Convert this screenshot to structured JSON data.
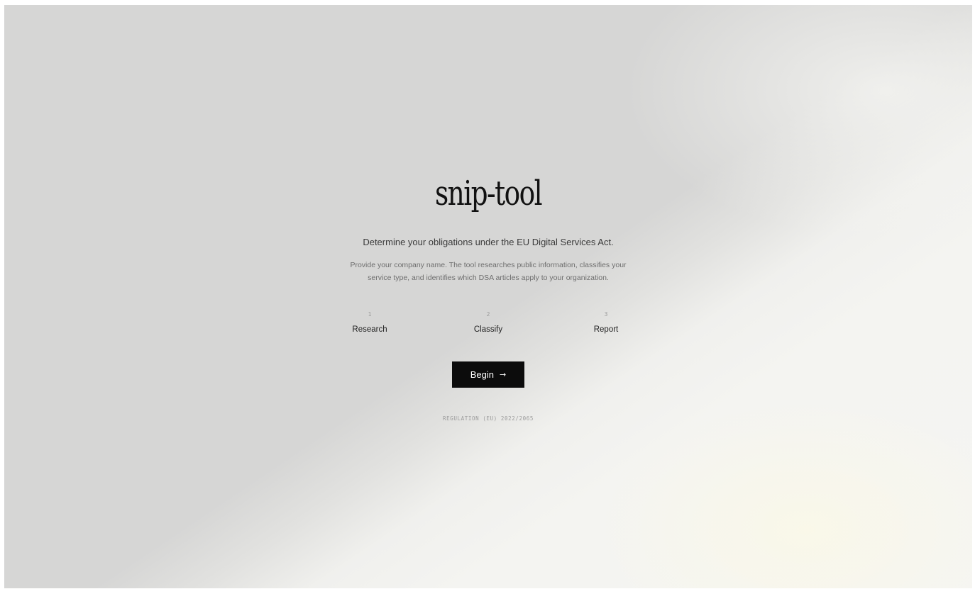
{
  "app": {
    "title": "snip-tool",
    "subtitle": "Determine your obligations under the EU Digital Services Act.",
    "description": "Provide your company name. The tool researches public information, classifies your service type, and identifies which DSA articles apply to your organization."
  },
  "steps": [
    {
      "number": "1",
      "label": "Research"
    },
    {
      "number": "2",
      "label": "Classify"
    },
    {
      "number": "3",
      "label": "Report"
    }
  ],
  "actions": {
    "begin_label": "Begin",
    "begin_icon": "arrow-right-icon",
    "begin_glyph": "→"
  },
  "footer": {
    "regulation": "REGULATION (EU) 2022/2065"
  },
  "colors": {
    "background": "#d6d6d5",
    "button": "#0c0c0c",
    "button_text": "#ffffff",
    "title": "#111111"
  }
}
